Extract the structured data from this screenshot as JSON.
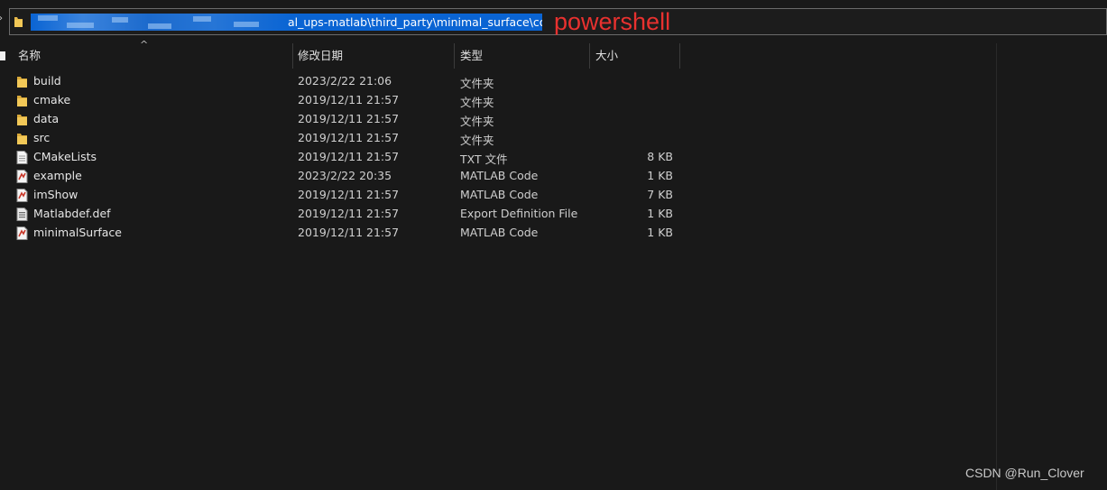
{
  "address_bar": {
    "path_visible": "al_ups-matlab\\third_party\\minimal_surface\\code",
    "annotation": "powershell"
  },
  "columns": {
    "name": "名称",
    "date": "修改日期",
    "type": "类型",
    "size": "大小"
  },
  "files": [
    {
      "name": "build",
      "date": "2023/2/22 21:06",
      "type": "文件夹",
      "size": "",
      "icon": "folder-icon"
    },
    {
      "name": "cmake",
      "date": "2019/12/11 21:57",
      "type": "文件夹",
      "size": "",
      "icon": "folder-icon"
    },
    {
      "name": "data",
      "date": "2019/12/11 21:57",
      "type": "文件夹",
      "size": "",
      "icon": "folder-icon"
    },
    {
      "name": "src",
      "date": "2019/12/11 21:57",
      "type": "文件夹",
      "size": "",
      "icon": "folder-icon"
    },
    {
      "name": "CMakeLists",
      "date": "2019/12/11 21:57",
      "type": "TXT 文件",
      "size": "8 KB",
      "icon": "text-file-icon"
    },
    {
      "name": "example",
      "date": "2023/2/22 20:35",
      "type": "MATLAB Code",
      "size": "1 KB",
      "icon": "matlab-file-icon"
    },
    {
      "name": "imShow",
      "date": "2019/12/11 21:57",
      "type": "MATLAB Code",
      "size": "7 KB",
      "icon": "matlab-file-icon"
    },
    {
      "name": "Matlabdef.def",
      "date": "2019/12/11 21:57",
      "type": "Export Definition File",
      "size": "1 KB",
      "icon": "def-file-icon"
    },
    {
      "name": "minimalSurface",
      "date": "2019/12/11 21:57",
      "type": "MATLAB Code",
      "size": "1 KB",
      "icon": "matlab-file-icon"
    }
  ],
  "watermark": "CSDN @Run_Clover",
  "colors": {
    "background": "#191919",
    "selection": "#0a64d3",
    "annotation": "#e8312f",
    "folder": "#e6b84a"
  }
}
